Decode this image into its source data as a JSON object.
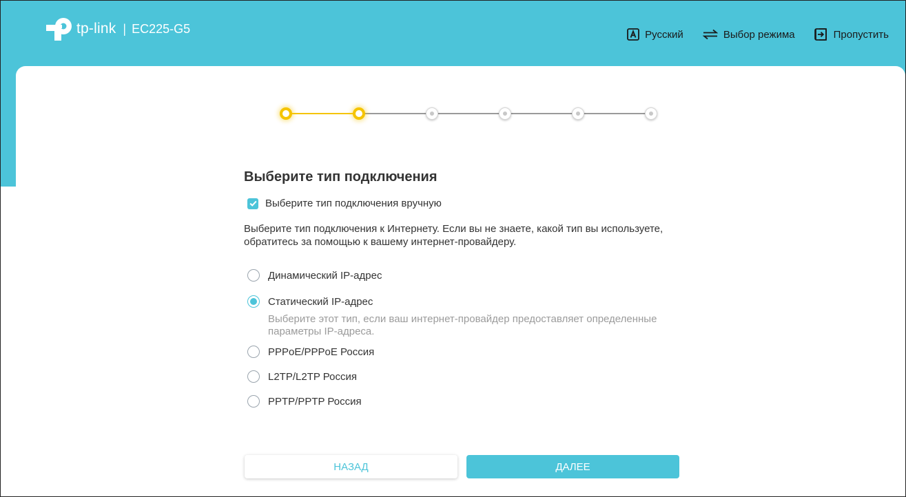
{
  "header": {
    "brand": "tp-link",
    "separator": "|",
    "model": "EC225-G5",
    "nav": {
      "language": "Русский",
      "mode": "Выбор режима",
      "skip": "Пропустить"
    }
  },
  "stepper": {
    "total_steps": 6,
    "current_step": 2
  },
  "page": {
    "title": "Выберите тип подключения",
    "manual_label": "Выберите тип подключения вручную",
    "manual_checked": true,
    "description": "Выберите тип подключения к Интернету. Если вы не знаете, какой тип вы используете, обратитесь за помощью к вашему интернет-провайдеру."
  },
  "options": [
    {
      "label": "Динамический IP-адрес",
      "selected": false
    },
    {
      "label": "Статический IP-адрес",
      "selected": true,
      "hint": "Выберите этот тип, если ваш интернет-провайдер предоставляет определенные параметры IP-адреса."
    },
    {
      "label": "PPPoE/PPPoE Россия",
      "selected": false
    },
    {
      "label": "L2TP/L2TP Россия",
      "selected": false
    },
    {
      "label": "PPTP/PPTP Россия",
      "selected": false
    }
  ],
  "buttons": {
    "back": "НАЗАД",
    "next": "ДАЛЕЕ"
  },
  "colors": {
    "accent": "#4cc4d9",
    "step_active": "#f5c400",
    "hint_text": "#9b9b9b"
  },
  "icons": {
    "language": "letter-a-box-icon",
    "mode": "swap-arrows-icon",
    "skip": "exit-arrow-icon",
    "logo": "tp-link-logo-icon"
  }
}
